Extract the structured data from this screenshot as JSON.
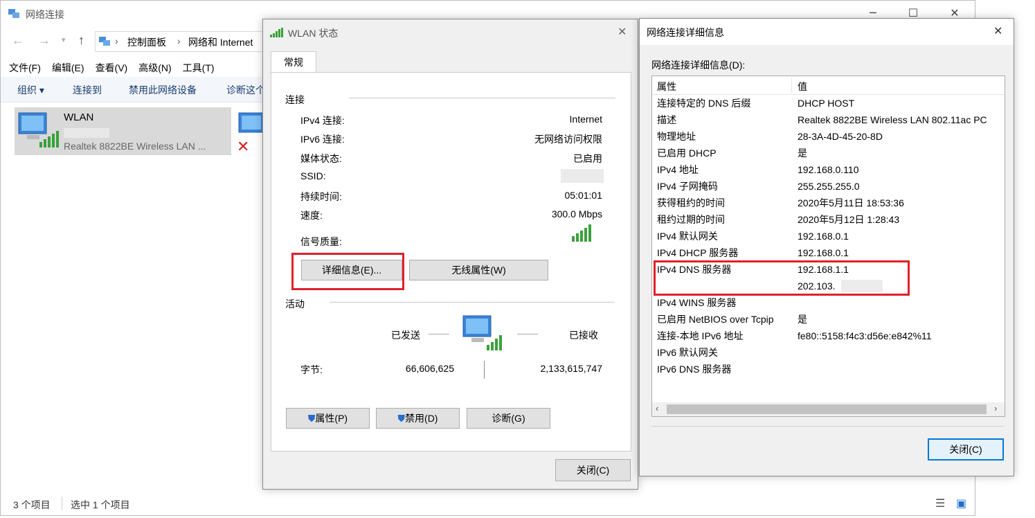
{
  "explorer": {
    "title": "网络连接",
    "breadcrumb": [
      "控制面板",
      "网络和 Internet"
    ],
    "menu": [
      "文件(F)",
      "编辑(E)",
      "查看(V)",
      "高级(N)",
      "工具(T)"
    ],
    "commands": [
      "组织 ▾",
      "连接到",
      "禁用此网络设备",
      "诊断这个"
    ],
    "adapter": {
      "name": "WLAN",
      "device": "Realtek 8822BE Wireless LAN ..."
    },
    "status": {
      "count": "3 个项目",
      "selected": "选中 1 个项目"
    }
  },
  "wlan_status": {
    "title": "WLAN 状态",
    "tab": "常规",
    "section_connection": "连接",
    "rows": [
      {
        "label": "IPv4 连接:",
        "value": "Internet"
      },
      {
        "label": "IPv6 连接:",
        "value": "无网络访问权限"
      },
      {
        "label": "媒体状态:",
        "value": "已启用"
      },
      {
        "label": "SSID:",
        "value": ""
      },
      {
        "label": "持续时间:",
        "value": "05:01:01"
      },
      {
        "label": "速度:",
        "value": "300.0 Mbps"
      }
    ],
    "signal_label": "信号质量:",
    "details_button": "详细信息(E)...",
    "wireless_button": "无线属性(W)",
    "section_activity": "活动",
    "sent_label": "已发送",
    "received_label": "已接收",
    "bytes_label": "字节:",
    "bytes_sent": "66,606,625",
    "bytes_received": "2,133,615,747",
    "properties_button": "属性(P)",
    "disable_button": "禁用(D)",
    "diagnose_button": "诊断(G)",
    "close_button": "关闭(C)"
  },
  "details": {
    "title": "网络连接详细信息",
    "list_label": "网络连接详细信息(D):",
    "col_property": "属性",
    "col_value": "值",
    "rows": [
      {
        "p": "连接特定的 DNS 后缀",
        "v": "DHCP HOST"
      },
      {
        "p": "描述",
        "v": "Realtek 8822BE Wireless LAN 802.11ac PC"
      },
      {
        "p": "物理地址",
        "v": "28-3A-4D-45-20-8D"
      },
      {
        "p": "已启用 DHCP",
        "v": "是"
      },
      {
        "p": "IPv4 地址",
        "v": "192.168.0.110"
      },
      {
        "p": "IPv4 子网掩码",
        "v": "255.255.255.0"
      },
      {
        "p": "获得租约的时间",
        "v": "2020年5月11日 18:53:36"
      },
      {
        "p": "租约过期的时间",
        "v": "2020年5月12日 1:28:43"
      },
      {
        "p": "IPv4 默认网关",
        "v": "192.168.0.1"
      },
      {
        "p": "IPv4 DHCP 服务器",
        "v": "192.168.0.1"
      },
      {
        "p": "IPv4 DNS 服务器",
        "v": "192.168.1.1"
      },
      {
        "p": "",
        "v": "202.103."
      },
      {
        "p": "IPv4 WINS 服务器",
        "v": ""
      },
      {
        "p": "已启用 NetBIOS over Tcpip",
        "v": "是"
      },
      {
        "p": "连接-本地 IPv6 地址",
        "v": "fe80::5158:f4c3:d56e:e842%11"
      },
      {
        "p": "IPv6 默认网关",
        "v": ""
      },
      {
        "p": "IPv6 DNS 服务器",
        "v": ""
      }
    ],
    "close_button": "关闭(C)"
  }
}
